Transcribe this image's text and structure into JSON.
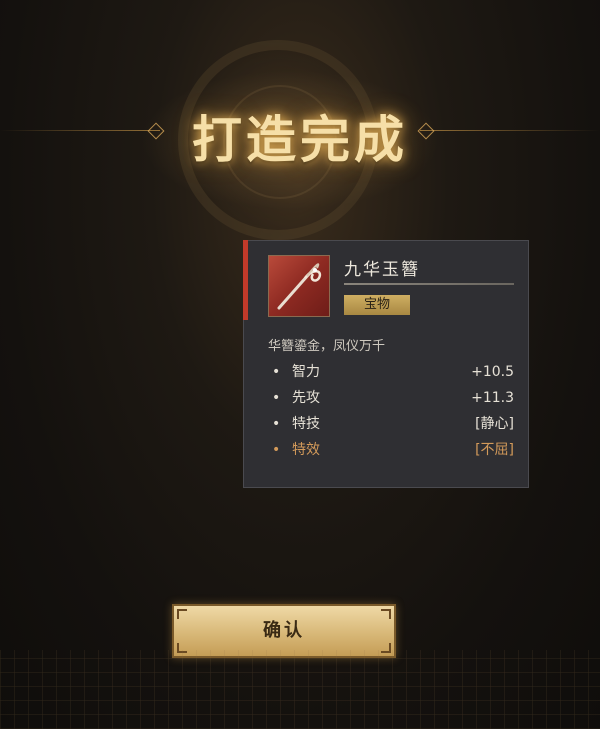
{
  "screen": {
    "title": "打造完成"
  },
  "item": {
    "name": "九华玉簪",
    "rarity": "宝物",
    "description": "华簪鎏金，凤仪万千",
    "stats": [
      {
        "name": "智力",
        "value": "+10.5"
      },
      {
        "name": "先攻",
        "value": "+11.3"
      },
      {
        "name": "特技",
        "value": "[静心]"
      },
      {
        "name": "特效",
        "value": "[不屈]"
      }
    ]
  },
  "actions": {
    "confirm_label": "确认"
  },
  "colors": {
    "title_glow": "#f6dfa8",
    "card_background": "#2f2f33",
    "rarity_badge": "#cfae62",
    "special_stat": "#d39a5a",
    "accent_red": "#c23a2a"
  }
}
